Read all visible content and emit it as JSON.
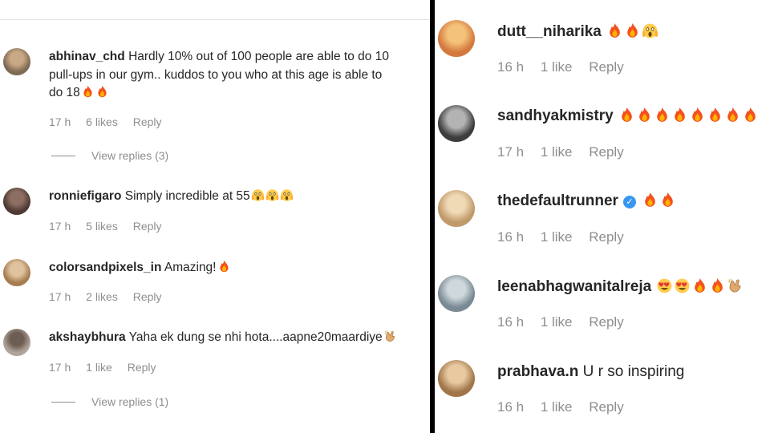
{
  "left_panel": {
    "comments": [
      {
        "username": "abhinav_chd",
        "lines": [
          "Hardly 10% out of 100 people are able to do 10",
          "pull-ups in our gym.. kuddos to you who at this age is able to",
          "do 18"
        ],
        "emojis": [
          "fire",
          "fire"
        ],
        "time": "17 h",
        "likes": "6 likes",
        "reply": "Reply",
        "view_replies": "View replies (3)",
        "avatar_colors": [
          "#7f6a55",
          "#c9a985"
        ]
      },
      {
        "username": "ronniefigaro",
        "lines": [
          "Simply incredible at 55"
        ],
        "emojis": [
          "scream",
          "scream",
          "scream"
        ],
        "time": "17 h",
        "likes": "5 likes",
        "reply": "Reply",
        "avatar_colors": [
          "#4e3a33",
          "#8d6e63"
        ]
      },
      {
        "username": "colorsandpixels_in",
        "lines": [
          "Amazing!"
        ],
        "emojis": [
          "fire"
        ],
        "time": "17 h",
        "likes": "2 likes",
        "reply": "Reply",
        "avatar_colors": [
          "#a67c52",
          "#e0c39e"
        ]
      },
      {
        "username": "akshaybhura",
        "lines": [
          "Yaha ek dung se nhi hota....aapne20maardiye"
        ],
        "emojis": [
          "clap"
        ],
        "time": "17 h",
        "likes": "1 like",
        "reply": "Reply",
        "view_replies": "View replies (1)",
        "avatar_colors": [
          "#b0a39a",
          "#6d5d52"
        ]
      }
    ]
  },
  "right_panel": {
    "comments": [
      {
        "username": "dutt__niharika",
        "lines": [
          ""
        ],
        "emojis": [
          "fire",
          "fire",
          "scream"
        ],
        "time": "16 h",
        "likes": "1 like",
        "reply": "Reply",
        "avatar_colors": [
          "#d47a3f",
          "#f4c27a"
        ]
      },
      {
        "username": "sandhyakmistry",
        "lines": [
          ""
        ],
        "emojis": [
          "fire",
          "fire",
          "fire",
          "fire",
          "fire",
          "fire",
          "fire",
          "fire"
        ],
        "time": "17 h",
        "likes": "1 like",
        "reply": "Reply",
        "avatar_colors": [
          "#3d3d3d",
          "#b3b3b3"
        ]
      },
      {
        "username": "thedefaultrunner",
        "verified": true,
        "lines": [
          ""
        ],
        "emojis": [
          "fire",
          "fire"
        ],
        "time": "16 h",
        "likes": "1 like",
        "reply": "Reply",
        "avatar_colors": [
          "#c19a6b",
          "#f0d9b5"
        ]
      },
      {
        "username": "leenabhagwanitalreja",
        "lines": [
          ""
        ],
        "emojis": [
          "hearteyes",
          "hearteyes",
          "fire",
          "fire",
          "clap"
        ],
        "time": "16 h",
        "likes": "1 like",
        "reply": "Reply",
        "avatar_colors": [
          "#7a8a95",
          "#cfd8dc"
        ]
      },
      {
        "username": "prabhava.n",
        "lines": [
          "U r so inspiring"
        ],
        "emojis": [],
        "time": "16 h",
        "likes": "1 like",
        "reply": "Reply",
        "avatar_colors": [
          "#a0764a",
          "#e8c9a0"
        ]
      }
    ]
  }
}
